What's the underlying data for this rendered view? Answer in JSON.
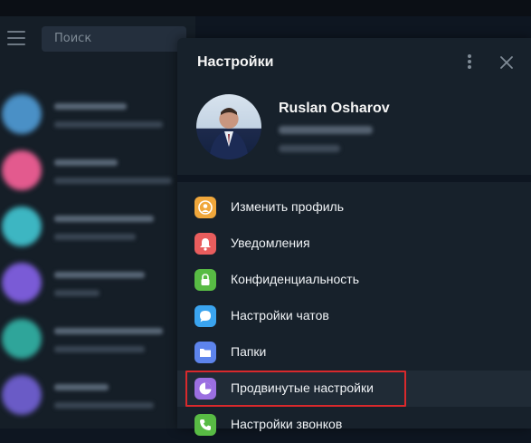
{
  "search": {
    "placeholder": "Поиск"
  },
  "settings": {
    "title": "Настройки",
    "profile": {
      "name": "Ruslan Osharov"
    },
    "items": [
      {
        "label": "Изменить профиль",
        "icon": "user-icon",
        "color": "#f0a73b"
      },
      {
        "label": "Уведомления",
        "icon": "bell-icon",
        "color": "#e95d5d"
      },
      {
        "label": "Конфиденциальность",
        "icon": "lock-icon",
        "color": "#58bb44"
      },
      {
        "label": "Настройки чатов",
        "icon": "chat-bubble-icon",
        "color": "#3aa4ef"
      },
      {
        "label": "Папки",
        "icon": "folder-icon",
        "color": "#5d84ec"
      },
      {
        "label": "Продвинутые настройки",
        "icon": "pie-chart-icon",
        "color": "#9b6fe1"
      },
      {
        "label": "Настройки звонков",
        "icon": "phone-icon",
        "color": "#58bb44"
      }
    ],
    "highlight_color": "#d9292c"
  }
}
